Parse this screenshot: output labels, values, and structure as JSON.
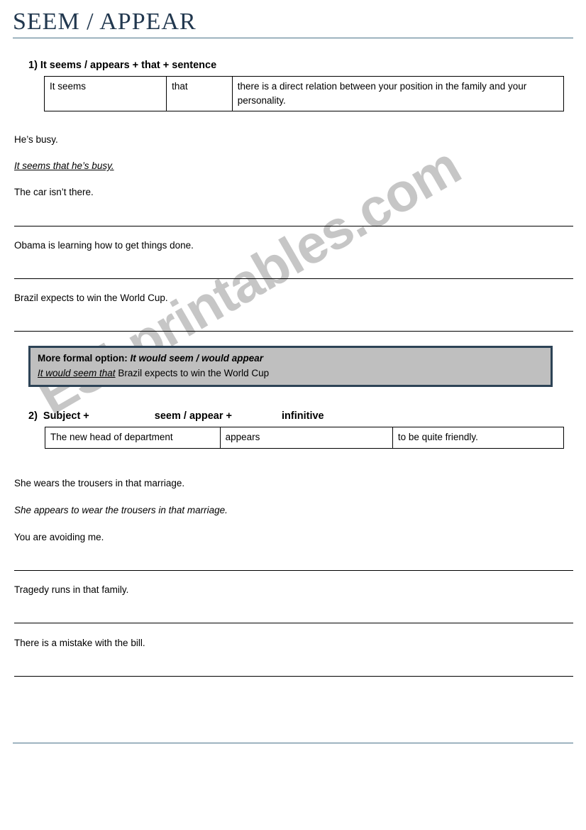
{
  "document": {
    "title": "SEEM / APPEAR",
    "watermark": "ESLprintables.com"
  },
  "section1": {
    "heading": "1)  It seems / appears + that + sentence",
    "table": {
      "columns": [
        "It seems",
        "that",
        "there is a direct relation between your position in the family and your personality."
      ]
    },
    "items": [
      {
        "prompt": "He’s busy.",
        "answer": "It seems that he’s busy.",
        "answer_style": "italic-underline"
      },
      {
        "prompt": "The car isn’t there.",
        "answer": "",
        "answer_style": "blank"
      },
      {
        "prompt": "Obama is learning how to get things done.",
        "answer": "",
        "answer_style": "blank"
      },
      {
        "prompt": "Brazil expects to win the World Cup.",
        "answer": "",
        "answer_style": "blank"
      }
    ]
  },
  "formal_box": {
    "label": "More formal option:",
    "forms": "It would seem / would appear",
    "example_prefix": "It would seem that",
    "example_rest": " Brazil expects to win the World Cup"
  },
  "section2": {
    "heading_number": "2)",
    "heading_part1": "Subject +",
    "heading_part2": "seem / appear +",
    "heading_part3": "infinitive",
    "table": {
      "columns": [
        "The new head of department",
        "appears",
        "to be quite friendly."
      ]
    },
    "items": [
      {
        "prompt": "She wears the trousers in that marriage.",
        "answer": "She appears to wear the trousers in that marriage.",
        "answer_style": "italic"
      },
      {
        "prompt": "You are avoiding me.",
        "answer": "",
        "answer_style": "blank"
      },
      {
        "prompt": "Tragedy runs in that family.",
        "answer": "",
        "answer_style": "blank"
      },
      {
        "prompt": "There is a mistake with the bill.",
        "answer": "",
        "answer_style": "blank"
      }
    ]
  },
  "colors": {
    "title": "#22384f",
    "rule": "#4a7289",
    "box_fill": "#bfbfbf",
    "box_border": "#2d4356",
    "watermark": "#c6c6c6"
  }
}
